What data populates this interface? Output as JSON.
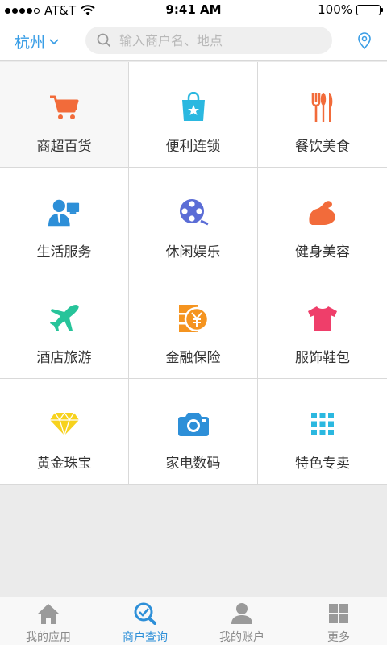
{
  "status_bar": {
    "carrier": "AT&T",
    "time": "9:41 AM",
    "battery": "100%"
  },
  "header": {
    "city": "杭州",
    "search_placeholder": "输入商户名、地点"
  },
  "categories": [
    {
      "label": "商超百货",
      "icon": "shopping-cart-icon",
      "color": "#f26b3a"
    },
    {
      "label": "便利连锁",
      "icon": "shopping-bag-icon",
      "color": "#2bb8e0"
    },
    {
      "label": "餐饮美食",
      "icon": "cutlery-icon",
      "color": "#f26b3a"
    },
    {
      "label": "生活服务",
      "icon": "service-person-icon",
      "color": "#2d8fd8"
    },
    {
      "label": "休闲娱乐",
      "icon": "film-reel-icon",
      "color": "#5b6dd6"
    },
    {
      "label": "健身美容",
      "icon": "flexed-arm-icon",
      "color": "#f26b3a"
    },
    {
      "label": "酒店旅游",
      "icon": "airplane-icon",
      "color": "#27c49a"
    },
    {
      "label": "金融保险",
      "icon": "finance-yen-icon",
      "color": "#f5941f"
    },
    {
      "label": "服饰鞋包",
      "icon": "t-shirt-icon",
      "color": "#ef3e6a"
    },
    {
      "label": "黄金珠宝",
      "icon": "diamond-icon",
      "color": "#f7d21d"
    },
    {
      "label": "家电数码",
      "icon": "camera-icon",
      "color": "#2d8fd8"
    },
    {
      "label": "特色专卖",
      "icon": "grid-dots-icon",
      "color": "#2bb8e0"
    }
  ],
  "tabbar": [
    {
      "label": "我的应用",
      "icon": "home-icon"
    },
    {
      "label": "商户查询",
      "icon": "search-check-icon"
    },
    {
      "label": "我的账户",
      "icon": "user-icon"
    },
    {
      "label": "更多",
      "icon": "more-grid-icon"
    }
  ],
  "colors": {
    "accent": "#2d8fd8",
    "city": "#3a9ee6",
    "tab_inactive": "#8a8a8a"
  }
}
